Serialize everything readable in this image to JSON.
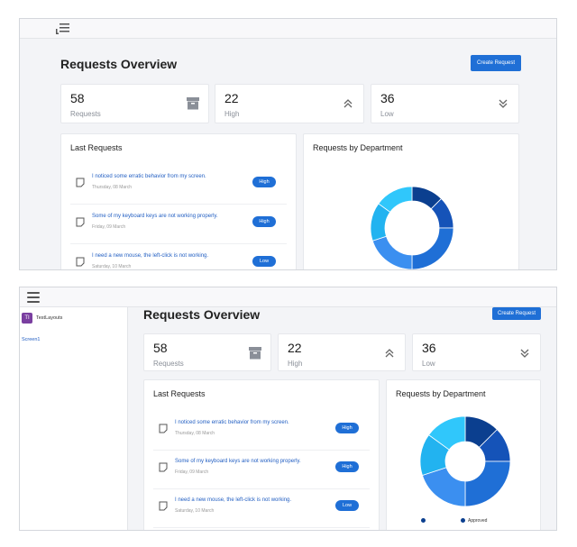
{
  "app": {
    "title": "Requests Overview",
    "create_button": "Create Request"
  },
  "sidebar": {
    "avatar_initials": "TI",
    "project_name": "TestLayouts",
    "screen_link": "Screen1"
  },
  "stats": [
    {
      "value": "58",
      "label": "Requests",
      "icon": "archive-icon"
    },
    {
      "value": "22",
      "label": "High",
      "icon": "chevron-double-up-icon"
    },
    {
      "value": "36",
      "label": "Low",
      "icon": "chevron-double-down-icon"
    }
  ],
  "last_requests": {
    "title": "Last Requests",
    "items": [
      {
        "text": "I noticed some erratic behavior from my screen.",
        "date": "Thursday, 08 March",
        "priority": "High"
      },
      {
        "text": "Some of my keyboard keys are not working properly.",
        "date": "Friday, 09 March",
        "priority": "High"
      },
      {
        "text": "I need a new mouse, the left-click is not working.",
        "date": "Saturday, 10 March",
        "priority": "Low"
      }
    ]
  },
  "department_chart": {
    "title": "Requests by Department",
    "legend": [
      "Approved"
    ]
  },
  "colors": {
    "accent": "#1f6fd6",
    "link": "#2460c3",
    "donut": [
      "#0b3f8f",
      "#1553b8",
      "#1f6fd6",
      "#3b8ff0",
      "#22b3f0",
      "#30c7fb"
    ]
  }
}
